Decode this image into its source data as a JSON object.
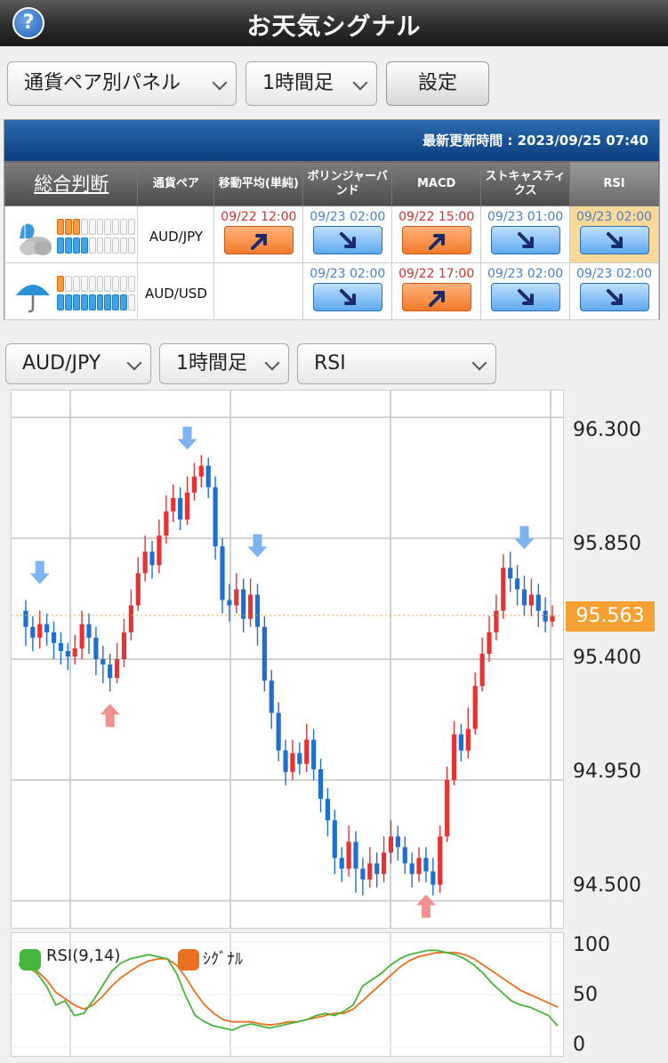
{
  "header": {
    "title": "お天気シグナル",
    "help_label": "?"
  },
  "toolbar": {
    "panel_select": "通貨ペア別パネル",
    "timeframe_select": "1時間足",
    "settings_label": "設定"
  },
  "panel": {
    "updated_label": "最新更新時間 : 2023/09/25 07:40",
    "headers": [
      "総合判断",
      "通貨ペア",
      "移動平均(単純)",
      "ボリンジャーバンド",
      "MACD",
      "ストキャスティクス",
      "RSI"
    ],
    "rows": [
      {
        "pair": "AUD/JPY",
        "weather": "cloudy-rain",
        "orange_bars": 3,
        "blue_bars": 4,
        "signals": [
          {
            "time": "09/22 12:00",
            "dir": "up"
          },
          {
            "time": "09/23 02:00",
            "dir": "down"
          },
          {
            "time": "09/22 15:00",
            "dir": "up"
          },
          {
            "time": "09/23 01:00",
            "dir": "down"
          },
          {
            "time": "09/23 02:00",
            "dir": "down"
          }
        ]
      },
      {
        "pair": "AUD/USD",
        "weather": "rain",
        "orange_bars": 1,
        "blue_bars": 9,
        "signals": [
          null,
          {
            "time": "09/23 02:00",
            "dir": "down"
          },
          {
            "time": "09/22 17:00",
            "dir": "up"
          },
          {
            "time": "09/23 02:00",
            "dir": "down"
          },
          {
            "time": "09/23 02:00",
            "dir": "down"
          }
        ]
      }
    ]
  },
  "chart_controls": {
    "pair_select": "AUD/JPY",
    "timeframe_select": "1時間足",
    "indicator_select": "RSI"
  },
  "chart_data": {
    "type": "candlestick",
    "pair": "AUD/JPY",
    "ylim": [
      94.4,
      96.4
    ],
    "y_ticks": [
      "96.300",
      "95.850",
      "95.400",
      "94.950",
      "94.500"
    ],
    "current_price": "95.563",
    "candles": [
      [
        95.58,
        95.52,
        95.62,
        95.45
      ],
      [
        95.52,
        95.48,
        95.56,
        95.43
      ],
      [
        95.48,
        95.53,
        95.58,
        95.44
      ],
      [
        95.53,
        95.5,
        95.57,
        95.45
      ],
      [
        95.5,
        95.46,
        95.54,
        95.4
      ],
      [
        95.46,
        95.43,
        95.5,
        95.38
      ],
      [
        95.43,
        95.41,
        95.46,
        95.36
      ],
      [
        95.41,
        95.44,
        95.49,
        95.38
      ],
      [
        95.44,
        95.53,
        95.58,
        95.4
      ],
      [
        95.53,
        95.48,
        95.57,
        95.42
      ],
      [
        95.48,
        95.4,
        95.52,
        95.34
      ],
      [
        95.4,
        95.38,
        95.45,
        95.31
      ],
      [
        95.38,
        95.33,
        95.42,
        95.28
      ],
      [
        95.33,
        95.4,
        95.46,
        95.31
      ],
      [
        95.4,
        95.5,
        95.55,
        95.37
      ],
      [
        95.5,
        95.6,
        95.66,
        95.47
      ],
      [
        95.6,
        95.72,
        95.78,
        95.58
      ],
      [
        95.72,
        95.8,
        95.86,
        95.69
      ],
      [
        95.8,
        95.75,
        95.84,
        95.7
      ],
      [
        95.75,
        95.86,
        95.92,
        95.72
      ],
      [
        95.86,
        95.95,
        96.01,
        95.83
      ],
      [
        95.95,
        96.0,
        96.05,
        95.91
      ],
      [
        96.0,
        95.92,
        96.04,
        95.88
      ],
      [
        95.92,
        96.02,
        96.08,
        95.9
      ],
      [
        96.02,
        96.08,
        96.13,
        95.99
      ],
      [
        96.08,
        96.12,
        96.16,
        96.04
      ],
      [
        96.12,
        96.04,
        96.15,
        96.0
      ],
      [
        96.04,
        95.82,
        96.08,
        95.77
      ],
      [
        95.82,
        95.62,
        95.85,
        95.57
      ],
      [
        95.62,
        95.6,
        95.68,
        95.54
      ],
      [
        95.6,
        95.66,
        95.72,
        95.57
      ],
      [
        95.66,
        95.55,
        95.7,
        95.5
      ],
      [
        95.55,
        95.64,
        95.7,
        95.52
      ],
      [
        95.64,
        95.52,
        95.68,
        95.45
      ],
      [
        95.52,
        95.32,
        95.56,
        95.28
      ],
      [
        95.32,
        95.2,
        95.36,
        95.14
      ],
      [
        95.2,
        95.06,
        95.24,
        95.02
      ],
      [
        95.06,
        94.98,
        95.1,
        94.93
      ],
      [
        94.98,
        95.05,
        95.1,
        94.95
      ],
      [
        95.05,
        95.01,
        95.09,
        94.97
      ],
      [
        95.01,
        95.1,
        95.16,
        94.98
      ],
      [
        95.1,
        94.99,
        95.14,
        94.95
      ],
      [
        94.99,
        94.88,
        95.03,
        94.83
      ],
      [
        94.88,
        94.8,
        94.92,
        94.74
      ],
      [
        94.8,
        94.66,
        94.84,
        94.6
      ],
      [
        94.66,
        94.62,
        94.7,
        94.57
      ],
      [
        94.62,
        94.72,
        94.78,
        94.59
      ],
      [
        94.72,
        94.62,
        94.76,
        94.53
      ],
      [
        94.62,
        94.58,
        94.66,
        94.52
      ],
      [
        94.58,
        94.64,
        94.7,
        94.55
      ],
      [
        94.64,
        94.6,
        94.68,
        94.55
      ],
      [
        94.6,
        94.68,
        94.74,
        94.57
      ],
      [
        94.68,
        94.74,
        94.8,
        94.64
      ],
      [
        94.74,
        94.7,
        94.78,
        94.65
      ],
      [
        94.7,
        94.64,
        94.74,
        94.6
      ],
      [
        94.64,
        94.6,
        94.68,
        94.55
      ],
      [
        94.6,
        94.66,
        94.7,
        94.57
      ],
      [
        94.66,
        94.61,
        94.7,
        94.57
      ],
      [
        94.61,
        94.56,
        94.66,
        94.52
      ],
      [
        94.56,
        94.74,
        94.78,
        94.53
      ],
      [
        94.74,
        94.95,
        95.0,
        94.72
      ],
      [
        94.95,
        95.12,
        95.17,
        94.93
      ],
      [
        95.12,
        95.06,
        95.16,
        95.02
      ],
      [
        95.06,
        95.14,
        95.22,
        95.03
      ],
      [
        95.14,
        95.3,
        95.35,
        95.12
      ],
      [
        95.3,
        95.42,
        95.48,
        95.28
      ],
      [
        95.42,
        95.5,
        95.56,
        95.39
      ],
      [
        95.5,
        95.58,
        95.64,
        95.47
      ],
      [
        95.58,
        95.74,
        95.79,
        95.55
      ],
      [
        95.74,
        95.7,
        95.8,
        95.65
      ],
      [
        95.7,
        95.66,
        95.75,
        95.6
      ],
      [
        95.66,
        95.6,
        95.71,
        95.56
      ],
      [
        95.6,
        95.64,
        95.7,
        95.56
      ],
      [
        95.64,
        95.58,
        95.68,
        95.52
      ],
      [
        95.58,
        95.54,
        95.63,
        95.5
      ],
      [
        95.54,
        95.56,
        95.6,
        95.52
      ]
    ],
    "signal_arrows": [
      {
        "type": "down",
        "candle": 2
      },
      {
        "type": "up",
        "candle": 12
      },
      {
        "type": "down",
        "candle": 23
      },
      {
        "type": "down",
        "candle": 33
      },
      {
        "type": "up",
        "candle": 57
      },
      {
        "type": "down",
        "candle": 71
      }
    ],
    "rsi": {
      "legend_rsi": "RSI(9,14)",
      "legend_signal": "ｼｸﾞﾅﾙ",
      "ylim": [
        0,
        100
      ],
      "y_ticks": [
        "100",
        "50",
        "0"
      ],
      "colors": {
        "rsi": "#45b43a",
        "signal": "#e8701e"
      },
      "rsi_values": [
        80,
        76,
        70,
        58,
        40,
        44,
        30,
        32,
        44,
        58,
        72,
        80,
        84,
        86,
        88,
        86,
        84,
        70,
        48,
        30,
        24,
        20,
        18,
        16,
        20,
        22,
        20,
        18,
        20,
        22,
        24,
        26,
        30,
        32,
        30,
        34,
        40,
        58,
        64,
        70,
        78,
        84,
        88,
        90,
        92,
        92,
        90,
        88,
        84,
        78,
        70,
        60,
        52,
        44,
        40,
        38,
        34,
        30,
        20
      ],
      "signal_values": [
        78,
        78,
        72,
        64,
        52,
        46,
        40,
        36,
        40,
        48,
        58,
        66,
        72,
        78,
        82,
        84,
        84,
        78,
        66,
        52,
        40,
        32,
        26,
        24,
        24,
        24,
        22,
        21,
        22,
        24,
        24,
        26,
        28,
        30,
        32,
        32,
        36,
        44,
        52,
        60,
        68,
        76,
        82,
        86,
        88,
        90,
        90,
        90,
        88,
        84,
        78,
        72,
        66,
        60,
        54,
        50,
        46,
        42,
        38
      ]
    }
  }
}
